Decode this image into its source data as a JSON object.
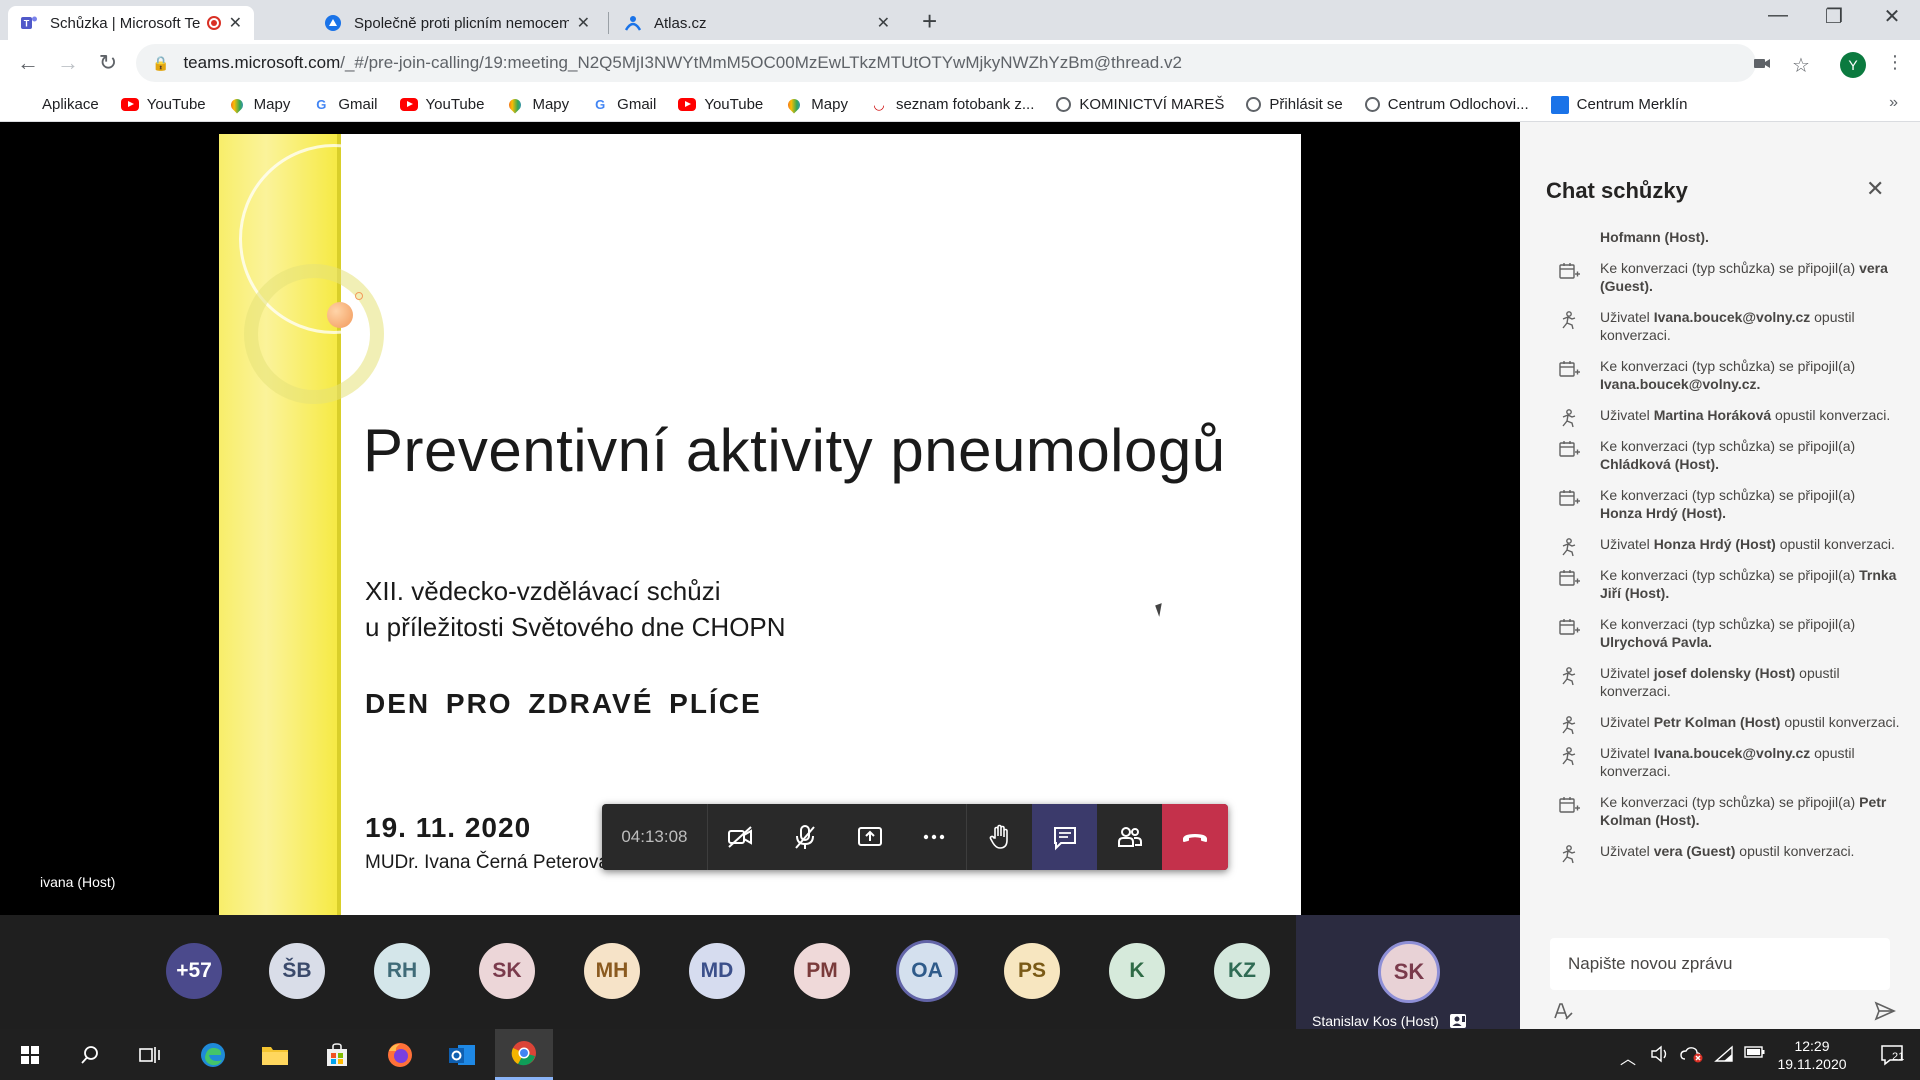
{
  "browser": {
    "tabs": [
      {
        "title": "Schůzka | Microsoft Teams",
        "recording": true
      },
      {
        "title": "Společně proti plicním nemocem"
      },
      {
        "title": "Atlas.cz"
      }
    ],
    "url": {
      "host": "teams.microsoft.com",
      "path": "/_#/pre-join-calling/19:meeting_N2Q5MjI3NWYtMmM5OC00MzEwLTkzMTUtOTYwMjkyNWZhYzBm@thread.v2"
    },
    "profile_initial": "Y",
    "bookmarks": [
      {
        "label": "Aplikace",
        "icon": "apps-grid-icon"
      },
      {
        "label": "YouTube",
        "icon": "youtube-icon"
      },
      {
        "label": "Mapy",
        "icon": "maps-pin-icon"
      },
      {
        "label": "Gmail",
        "icon": "google-icon"
      },
      {
        "label": "YouTube",
        "icon": "youtube-icon"
      },
      {
        "label": "Mapy",
        "icon": "maps-pin-icon"
      },
      {
        "label": "Gmail",
        "icon": "google-icon"
      },
      {
        "label": "YouTube",
        "icon": "youtube-icon"
      },
      {
        "label": "Mapy",
        "icon": "maps-pin-icon"
      },
      {
        "label": "seznam fotobank z...",
        "icon": "seznam-icon"
      },
      {
        "label": "KOMINICTVÍ MAREŠ",
        "icon": "globe-icon"
      },
      {
        "label": "Přihlásit se",
        "icon": "globe-icon"
      },
      {
        "label": "Centrum Odlochovi...",
        "icon": "globe-icon"
      },
      {
        "label": "Centrum Merklín",
        "icon": "grid-blue-icon"
      }
    ],
    "more": "»"
  },
  "slide": {
    "title": "Preventivní aktivity pneumologů",
    "sub1": "XII. vědecko-vzdělávací schůzi",
    "sub2": "u příležitosti Světového dne CHOPN",
    "headline": "DEN  PRO  ZDRAVÉ  PLÍCE",
    "date": "19. 11. 2020",
    "author": "MUDr. Ivana Černá Peterová"
  },
  "stage": {
    "speaker": "ivana (Host)",
    "timer": "04:13:08"
  },
  "participants": [
    {
      "initials": "+57",
      "bg": "#4b4a8c",
      "fg": "#ffffff"
    },
    {
      "initials": "ŠB",
      "bg": "#d9dde8",
      "fg": "#3b4a6b"
    },
    {
      "initials": "RH",
      "bg": "#d4e6ea",
      "fg": "#3f6b78"
    },
    {
      "initials": "SK",
      "bg": "#ecd6d8",
      "fg": "#7a3b4c"
    },
    {
      "initials": "MH",
      "bg": "#f6e3c8",
      "fg": "#8a5a1f"
    },
    {
      "initials": "MD",
      "bg": "#d6dcef",
      "fg": "#3b4f8a"
    },
    {
      "initials": "PM",
      "bg": "#efd9d9",
      "fg": "#7a3b3b"
    },
    {
      "initials": "OA",
      "bg": "#d4e0ee",
      "fg": "#2f5b8a"
    },
    {
      "initials": "PS",
      "bg": "#f7e6c0",
      "fg": "#7a5a16"
    },
    {
      "initials": "K",
      "bg": "#d6eadb",
      "fg": "#2f6b46"
    },
    {
      "initials": "KZ",
      "bg": "#d4e8dd",
      "fg": "#2f6b54"
    }
  ],
  "self": {
    "initials": "SK",
    "name": "Stanislav Kos (Host)"
  },
  "chat": {
    "title": "Chat schůzky",
    "messages": [
      {
        "icon": "none",
        "pre": "",
        "bold": "Hofmann (Host).",
        "post": ""
      },
      {
        "icon": "join",
        "pre": "Ke konverzaci (typ schůzka) se připojil(a) ",
        "bold": "vera (Guest).",
        "post": ""
      },
      {
        "icon": "leave",
        "pre": "Uživatel ",
        "bold": "Ivana.boucek@volny.cz",
        "post": " opustil konverzaci."
      },
      {
        "icon": "join",
        "pre": "Ke konverzaci (typ schůzka) se připojil(a) ",
        "bold": "Ivana.boucek@volny.cz.",
        "post": ""
      },
      {
        "icon": "leave",
        "pre": "Uživatel ",
        "bold": "Martina Horáková",
        "post": " opustil konverzaci."
      },
      {
        "icon": "join",
        "pre": "Ke konverzaci (typ schůzka) se připojil(a) ",
        "bold": "Chládková (Host).",
        "post": ""
      },
      {
        "icon": "join",
        "pre": "Ke konverzaci (typ schůzka) se připojil(a) ",
        "bold": "Honza Hrdý (Host).",
        "post": ""
      },
      {
        "icon": "leave",
        "pre": "Uživatel ",
        "bold": "Honza Hrdý (Host)",
        "post": " opustil konverzaci."
      },
      {
        "icon": "join",
        "pre": "Ke konverzaci (typ schůzka) se připojil(a) ",
        "bold": "Trnka Jiří (Host).",
        "post": ""
      },
      {
        "icon": "join",
        "pre": "Ke konverzaci (typ schůzka) se připojil(a) ",
        "bold": "Ulrychová Pavla.",
        "post": ""
      },
      {
        "icon": "leave",
        "pre": "Uživatel ",
        "bold": "josef dolensky (Host)",
        "post": " opustil konverzaci."
      },
      {
        "icon": "leave",
        "pre": "Uživatel ",
        "bold": "Petr Kolman (Host)",
        "post": " opustil konverzaci."
      },
      {
        "icon": "leave",
        "pre": "Uživatel ",
        "bold": "Ivana.boucek@volny.cz",
        "post": " opustil konverzaci."
      },
      {
        "icon": "join",
        "pre": "Ke konverzaci (typ schůzka) se připojil(a) ",
        "bold": "Petr Kolman (Host).",
        "post": ""
      },
      {
        "icon": "leave",
        "pre": "Uživatel ",
        "bold": "vera (Guest)",
        "post": " opustil konverzaci."
      }
    ],
    "compose_placeholder": "Napište novou zprávu"
  },
  "taskbar": {
    "time": "12:29",
    "date": "19.11.2020",
    "notifications": "21"
  }
}
